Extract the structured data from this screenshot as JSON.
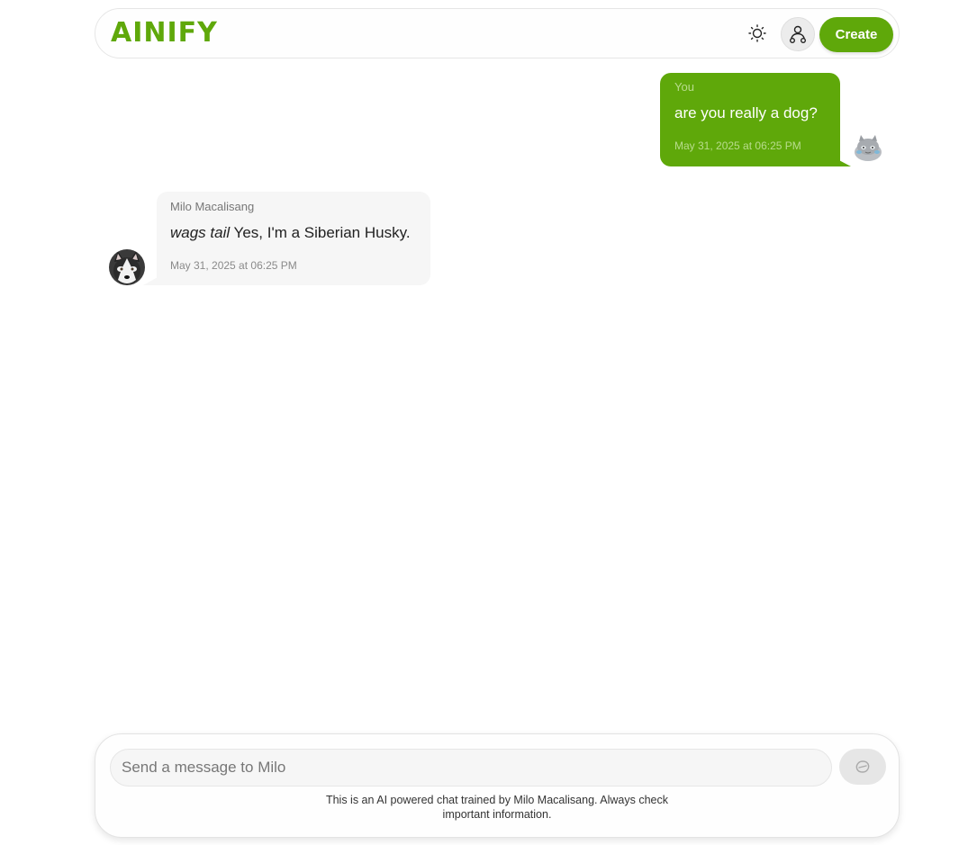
{
  "header": {
    "logo_text": "AINIFY",
    "create_label": "Create",
    "theme_icon": "sun-icon",
    "profile_icon": "user-profile-icon"
  },
  "messages": [
    {
      "sender": "You",
      "text": "are you really a dog?",
      "timestamp": "May 31, 2025 at 06:25 PM",
      "avatar": "user-avatar-cat"
    },
    {
      "sender": "Milo Macalisang",
      "text_emphasis": "wags tail",
      "text": " Yes, I'm a Siberian Husky.",
      "timestamp": "May 31, 2025 at 06:25 PM",
      "avatar": "husky-avatar"
    }
  ],
  "composer": {
    "placeholder": "Send a message to Milo",
    "value": "",
    "send_icon": "send-icon",
    "disclaimer": "This is an AI powered chat trained by Milo Macalisang. Always check important information."
  },
  "colors": {
    "accent": "#5fa80a",
    "bubble_bot": "#f6f6f6",
    "send_button": "#e6e6e6"
  }
}
